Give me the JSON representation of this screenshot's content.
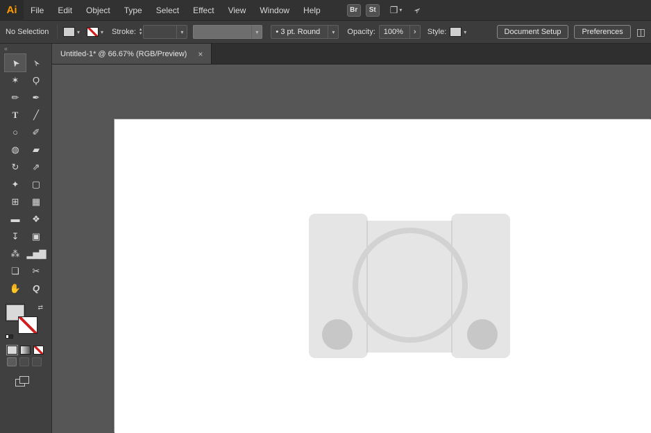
{
  "app": {
    "logo": "Ai"
  },
  "menubar": {
    "items": [
      "File",
      "Edit",
      "Object",
      "Type",
      "Select",
      "Effect",
      "View",
      "Window",
      "Help"
    ],
    "badges": [
      {
        "label": "Br"
      },
      {
        "label": "St"
      }
    ]
  },
  "icons": {
    "workspace": "❐",
    "caret": "▾",
    "spinner_up": "▴",
    "spinner_down": "▾",
    "chevron_right": "›",
    "swap": "⇄",
    "gpu": "➣",
    "panel": "◫",
    "collapse": "«"
  },
  "controlbar": {
    "selection_status": "No Selection",
    "stroke_label": "Stroke:",
    "brush_bullet": "•",
    "brush_value": "3 pt. Round",
    "opacity_label": "Opacity:",
    "opacity_value": "100%",
    "style_label": "Style:",
    "document_setup": "Document Setup",
    "preferences": "Preferences"
  },
  "document_tab": {
    "title": "Untitled-1* @ 66.67% (RGB/Preview)",
    "close": "×"
  },
  "toolbar": {
    "tools": [
      {
        "name": "selection",
        "glyph": "➤",
        "active": true
      },
      {
        "name": "direct-selection",
        "glyph": "➢"
      },
      {
        "name": "magic-wand",
        "glyph": "✶"
      },
      {
        "name": "lasso",
        "glyph": "Ϙ"
      },
      {
        "name": "pencil",
        "glyph": "✏"
      },
      {
        "name": "pen",
        "glyph": "✒"
      },
      {
        "name": "type",
        "glyph": "T"
      },
      {
        "name": "line-segment",
        "glyph": "╱"
      },
      {
        "name": "ellipse",
        "glyph": "○"
      },
      {
        "name": "paintbrush",
        "glyph": "✐"
      },
      {
        "name": "shape-builder",
        "glyph": "◍"
      },
      {
        "name": "eraser",
        "glyph": "▰"
      },
      {
        "name": "rotate",
        "glyph": "↻"
      },
      {
        "name": "scale",
        "glyph": "⇗"
      },
      {
        "name": "width",
        "glyph": "✦"
      },
      {
        "name": "free-transform",
        "glyph": "▢"
      },
      {
        "name": "perspective-grid",
        "glyph": "⊞"
      },
      {
        "name": "mesh",
        "glyph": "▦"
      },
      {
        "name": "gradient",
        "glyph": "▬"
      },
      {
        "name": "blend",
        "glyph": "❖"
      },
      {
        "name": "eyedropper",
        "glyph": "↧"
      },
      {
        "name": "live-paint",
        "glyph": "▣"
      },
      {
        "name": "symbol-sprayer",
        "glyph": "⁂"
      },
      {
        "name": "column-graph",
        "glyph": "▂▅▇"
      },
      {
        "name": "artboard",
        "glyph": "❏"
      },
      {
        "name": "slice",
        "glyph": "✂"
      },
      {
        "name": "hand",
        "glyph": "✋"
      },
      {
        "name": "zoom",
        "glyph": "Q"
      }
    ]
  },
  "colors": {
    "accent_logo": "#ff9a00",
    "menubar_bg": "#323232",
    "canvas_bg": "#565656",
    "artboard": "#ffffff",
    "artwork_fill": "#e5e5e5",
    "artwork_ring": "#d2d2d2",
    "artwork_button": "#c7c7c7",
    "stroke_none_red": "#d21e1e"
  },
  "artwork": {
    "description": "light-gray console illustration: two rounded side pillars, center panel, large disc ring outline, two small corner buttons"
  }
}
